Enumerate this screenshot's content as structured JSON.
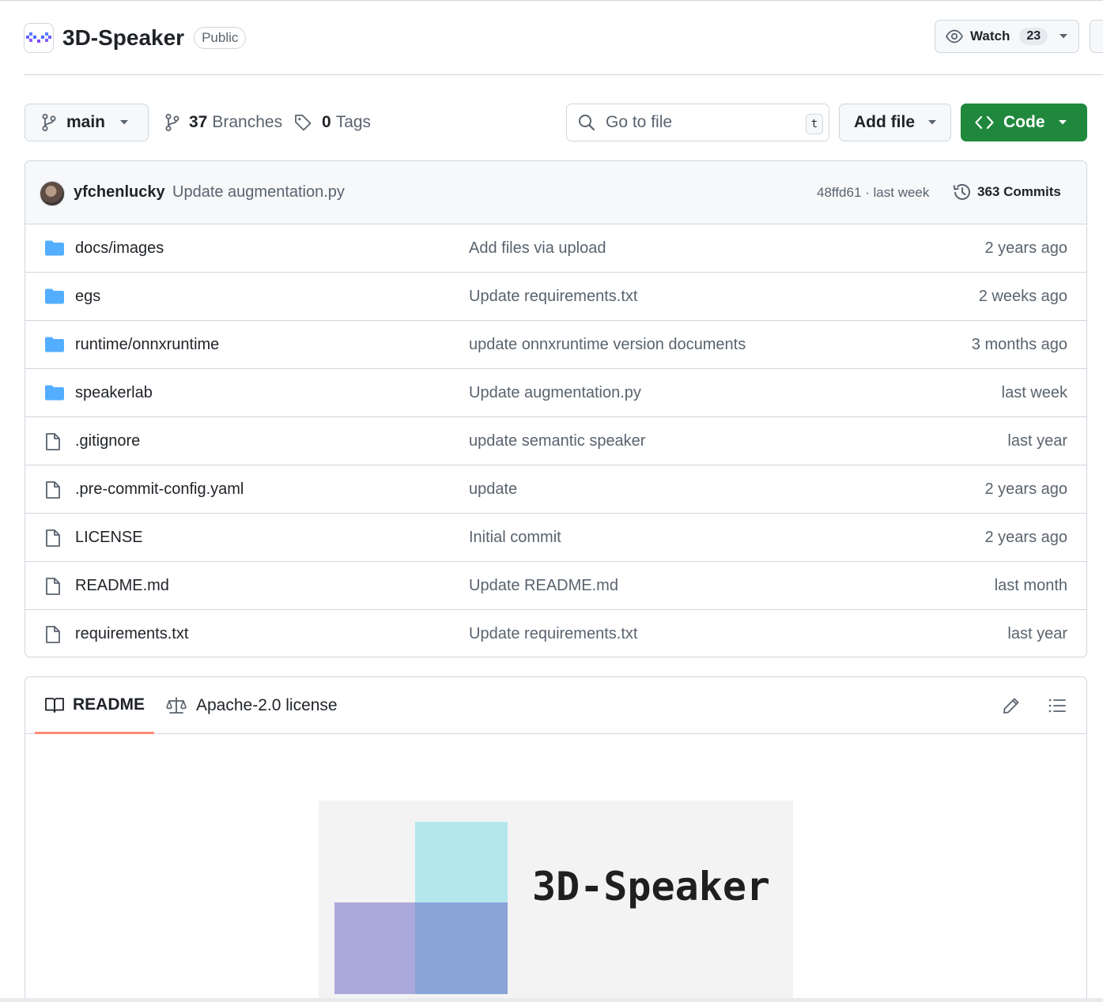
{
  "repo": {
    "name": "3D-Speaker",
    "visibility": "Public",
    "watch_label": "Watch",
    "watch_count": "23"
  },
  "toolbar": {
    "branch": "main",
    "branches_count": "37",
    "branches_label": "Branches",
    "tags_count": "0",
    "tags_label": "Tags",
    "goto_placeholder": "Go to file",
    "goto_shortcut": "t",
    "add_file_label": "Add file",
    "code_label": "Code"
  },
  "latest_commit": {
    "author": "yfchenlucky",
    "message": "Update augmentation.py",
    "meta": "48ffd61 · last week",
    "commits_label": "363 Commits"
  },
  "files": [
    {
      "name": "docs/images",
      "type": "folder",
      "commit": "Add files via upload",
      "age": "2 years ago"
    },
    {
      "name": "egs",
      "type": "folder",
      "commit": "Update requirements.txt",
      "age": "2 weeks ago"
    },
    {
      "name": "runtime/onnxruntime",
      "type": "folder",
      "commit": "update onnxruntime version documents",
      "age": "3 months ago"
    },
    {
      "name": "speakerlab",
      "type": "folder",
      "commit": "Update augmentation.py",
      "age": "last week"
    },
    {
      "name": ".gitignore",
      "type": "file",
      "commit": "update semantic speaker",
      "age": "last year"
    },
    {
      "name": ".pre-commit-config.yaml",
      "type": "file",
      "commit": "update",
      "age": "2 years ago"
    },
    {
      "name": "LICENSE",
      "type": "file",
      "commit": "Initial commit",
      "age": "2 years ago"
    },
    {
      "name": "README.md",
      "type": "file",
      "commit": "Update README.md",
      "age": "last month"
    },
    {
      "name": "requirements.txt",
      "type": "file",
      "commit": "Update requirements.txt",
      "age": "last year"
    }
  ],
  "readme": {
    "tab_readme": "README",
    "tab_license": "Apache-2.0 license",
    "banner_text": "3D-Speaker"
  },
  "colors": {
    "accent_green": "#1f883d",
    "folder_blue": "#54aeff",
    "tab_underline": "#fd8c73"
  }
}
